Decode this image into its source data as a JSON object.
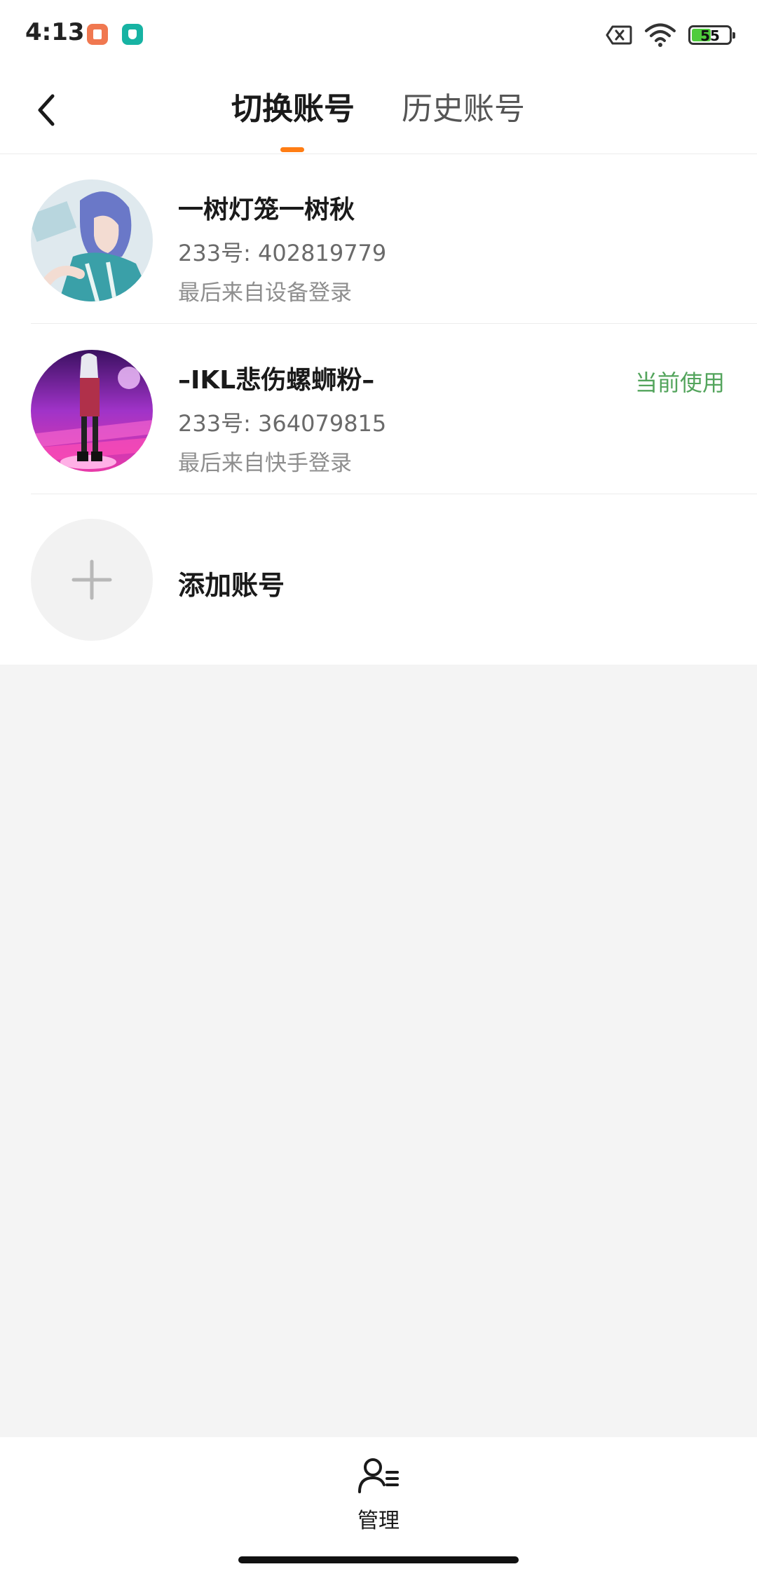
{
  "status_bar": {
    "time": "4:13",
    "battery": {
      "percent": 55,
      "label": "55"
    },
    "icons": [
      "clipboard-app-icon",
      "shield-app-icon",
      "sim-icon",
      "wifi-icon",
      "battery-icon"
    ],
    "colors": {
      "battery_fill": "#4fcc3c"
    }
  },
  "header": {
    "back_icon": "chevron-left-icon",
    "tabs": [
      {
        "label": "切换账号",
        "active": true
      },
      {
        "label": "历史账号",
        "active": false
      }
    ],
    "accent_color": "#ff7d14"
  },
  "accounts": [
    {
      "name": "一树灯笼一树秋",
      "id_text": "233号: 402819779",
      "source": "最后来自设备登录",
      "current_label": ""
    },
    {
      "name": "–IKL悲伤螺蛳粉–",
      "id_text": "233号: 364079815",
      "source": "最后来自快手登录",
      "current_label": "当前使用"
    }
  ],
  "add_account": {
    "label": "添加账号",
    "icon": "plus-icon"
  },
  "bottom_bar": {
    "manage_label": "管理",
    "manage_icon": "user-list-icon"
  },
  "colors": {
    "current_badge": "#53a45c",
    "page_background": "#f4f4f4"
  }
}
